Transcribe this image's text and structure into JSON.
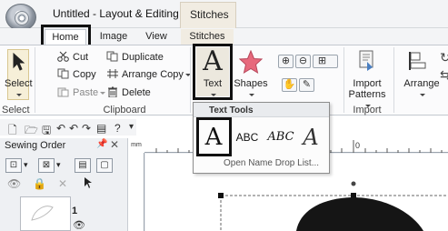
{
  "window": {
    "title": "Untitled - Layout & Editing",
    "context_tab": "Stitches"
  },
  "tabs": [
    {
      "label": "Home",
      "selected": true
    },
    {
      "label": "Image"
    },
    {
      "label": "View"
    },
    {
      "label": "Stitches"
    }
  ],
  "ribbon": {
    "select": {
      "label": "Select"
    },
    "clipboard": {
      "cut": "Cut",
      "copy": "Copy",
      "paste": "Paste",
      "duplicate": "Duplicate",
      "arrange_copy": "Arrange Copy",
      "delete": "Delete",
      "group_label": "Clipboard"
    },
    "text": {
      "label": "Text"
    },
    "shapes": {
      "label": "Shapes"
    },
    "import": {
      "label_line1": "Import",
      "label_line2": "Patterns",
      "group_label": "Import"
    },
    "arrange": {
      "label": "Arrange"
    }
  },
  "dropdown": {
    "title": "Text Tools",
    "items": [
      "A",
      "ABC",
      "ABC",
      "A"
    ],
    "link": "Open Name Drop List..."
  },
  "sewing_order": {
    "title": "Sewing Order",
    "item_number": "1"
  },
  "ruler": {
    "zero": "0",
    "corner": "mm"
  },
  "colors": {
    "highlight": "#111111",
    "ribbon_bg": "#fbfbfc",
    "context_tab": "#f1ece2"
  }
}
